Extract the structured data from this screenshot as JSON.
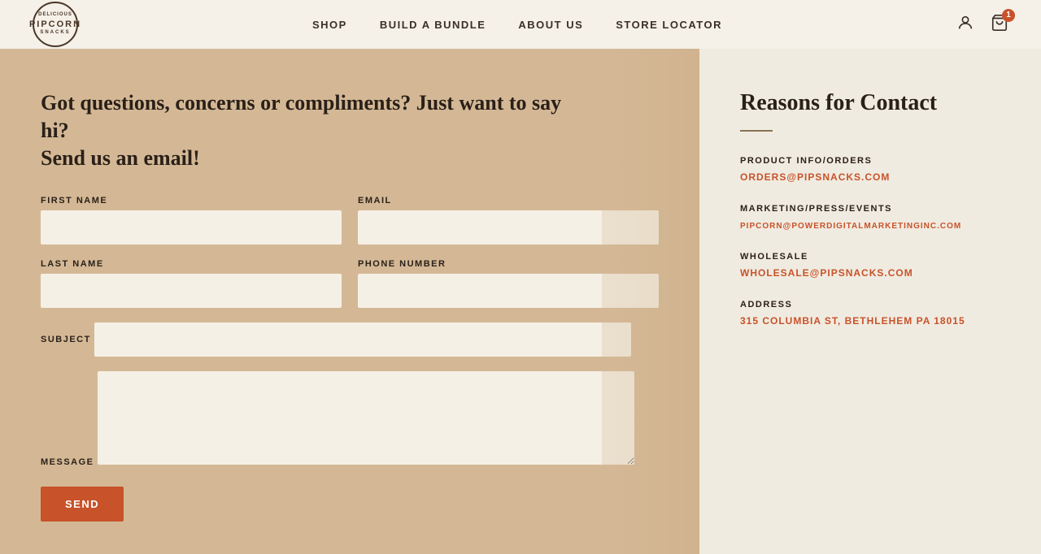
{
  "header": {
    "logo": {
      "line1": "Delicious",
      "main": "PIPCORN",
      "line3": "SNACKS"
    },
    "nav": {
      "items": [
        {
          "label": "SHOP",
          "href": "#"
        },
        {
          "label": "BUILD A BUNDLE",
          "href": "#"
        },
        {
          "label": "ABOUT US",
          "href": "#",
          "active": true
        },
        {
          "label": "STORE LOCATOR",
          "href": "#"
        }
      ]
    },
    "cart_count": "1"
  },
  "form_section": {
    "heading_line1": "Got questions, concerns or compliments? Just want to say hi?",
    "heading_line2": "Send us an email!",
    "fields": {
      "first_name_label": "FIRST NAME",
      "email_label": "EMAIL",
      "last_name_label": "LAST NAME",
      "phone_label": "PHONE NUMBER",
      "subject_label": "SUBJECT",
      "message_label": "MESSAGE"
    },
    "send_button": "SEND"
  },
  "reasons_section": {
    "heading": "Reasons for Contact",
    "items": [
      {
        "category": "PRODUCT INFO/ORDERS",
        "email": "ORDERS@PIPSNACKS.COM"
      },
      {
        "category": "MARKETING/PRESS/EVENTS",
        "email": "PIPCORN@POWERDIGITALMARKETINGINC.COM"
      },
      {
        "category": "WHOLESALE",
        "email": "WHOLESALE@PIPSNACKS.COM"
      },
      {
        "category": "ADDRESS",
        "email": "315 COLUMBIA ST, BETHLEHEM PA 18015"
      }
    ]
  }
}
